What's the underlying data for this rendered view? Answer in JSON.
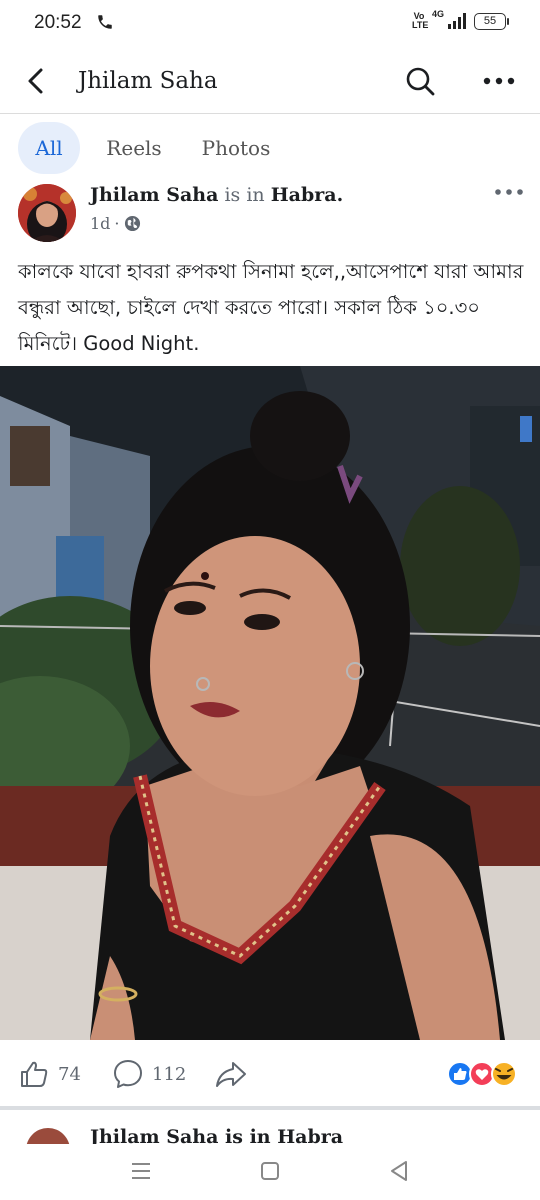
{
  "status_bar": {
    "time": "20:52",
    "volte": "Vo LTE",
    "network": "4G",
    "battery": "55"
  },
  "header": {
    "title": "Jhilam Saha"
  },
  "tabs": [
    {
      "label": "All",
      "active": true
    },
    {
      "label": "Reels",
      "active": false
    },
    {
      "label": "Photos",
      "active": false
    }
  ],
  "post": {
    "author": "Jhilam Saha",
    "is_in": "is in",
    "place": "Habra.",
    "time": "1d",
    "separator": "·",
    "privacy_icon": "globe-icon",
    "text": "কালকে যাবো হাবরা রুপকথা সিনামা হলে,,আসেপাশে যারা আমার বন্ধুরা আছো, চাইলে দেখা করতে পারো। সকাল ঠিক ১০.৩০ মিনিটে। Good Night.",
    "likes": "74",
    "comments": "112",
    "reactions": [
      "like",
      "love",
      "haha"
    ]
  },
  "next_post": {
    "author_partial": "Jhilam Saha is in Habra"
  },
  "colors": {
    "accent": "#1b67d7",
    "tab_active_bg": "#e6eefb",
    "like_blue": "#1877f2",
    "love_red": "#f33e58",
    "haha_yellow": "#f7b125"
  }
}
